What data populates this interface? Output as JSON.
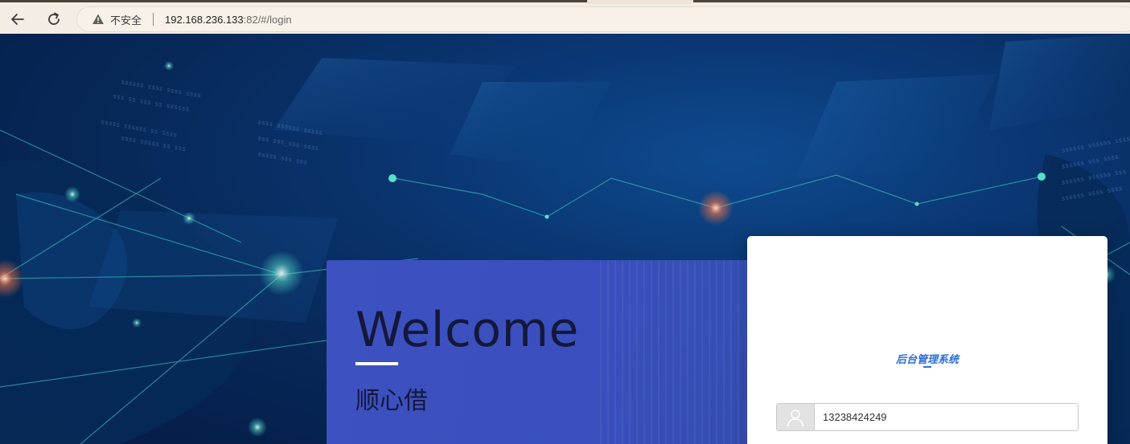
{
  "browser": {
    "security_label": "不安全",
    "url_host": "192.168.236.133",
    "url_rest": ":82/#/login"
  },
  "welcome": {
    "title": "Welcome",
    "subtitle": "顺心借"
  },
  "login": {
    "system_title": "后台管理系统",
    "username_value": "13238424249"
  },
  "colors": {
    "accent": "#2b6ed6",
    "welcome_panel": "#3d52c0",
    "background": "#0a3672"
  },
  "icons": {
    "back": "arrow-left-icon",
    "reload": "reload-icon",
    "warning": "warning-triangle-icon",
    "user": "user-icon"
  }
}
